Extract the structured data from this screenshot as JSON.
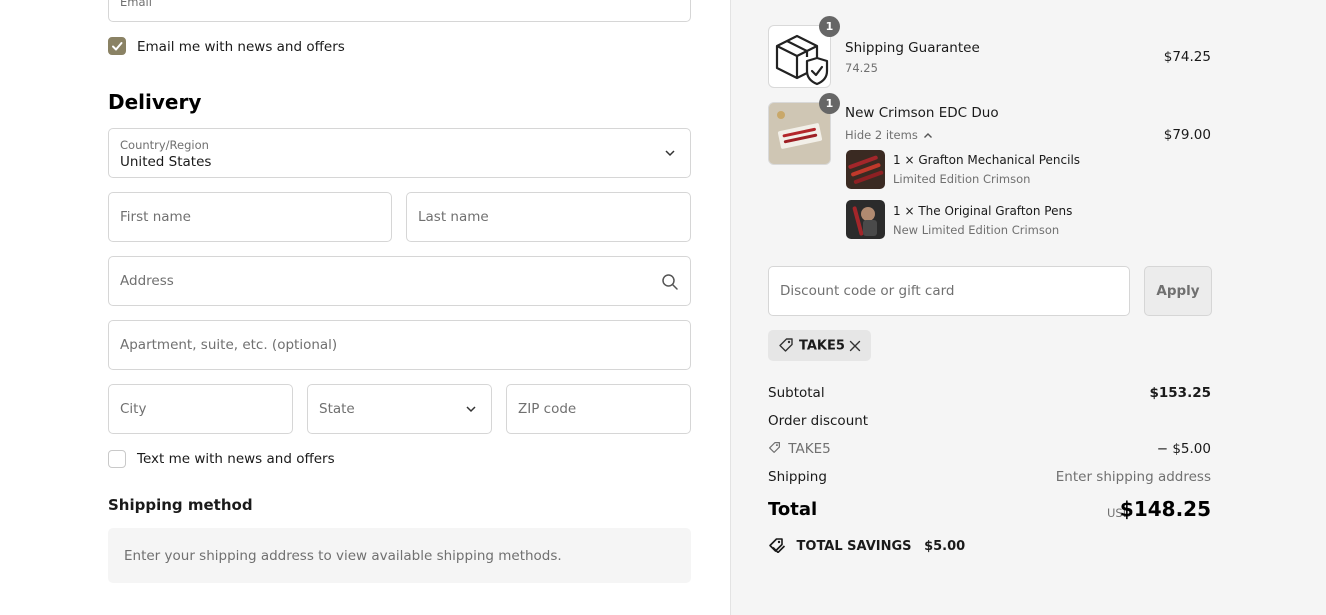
{
  "contact": {
    "email_placeholder": "Email",
    "news_checkbox_label": "Email me with news and offers",
    "news_checked": true
  },
  "delivery": {
    "heading": "Delivery",
    "country_label": "Country/Region",
    "country_value": "United States",
    "first_name_placeholder": "First name",
    "last_name_placeholder": "Last name",
    "address_placeholder": "Address",
    "apartment_placeholder": "Apartment, suite, etc. (optional)",
    "city_placeholder": "City",
    "state_placeholder": "State",
    "zip_placeholder": "ZIP code",
    "sms_checkbox_label": "Text me with news and offers",
    "sms_checked": false
  },
  "shipping_method": {
    "heading": "Shipping method",
    "message": "Enter your shipping address to view available shipping methods."
  },
  "order": {
    "items": [
      {
        "title": "Shipping Guarantee",
        "subtitle": "74.25",
        "price": "$74.25",
        "quantity": "1",
        "icon": "package-shield-icon"
      },
      {
        "title": "New Crimson EDC Duo",
        "toggle_label": "Hide 2 items",
        "price": "$79.00",
        "quantity": "1",
        "subitems": [
          {
            "title": "1 × Grafton Mechanical Pencils",
            "subtitle": "Limited Edition Crimson"
          },
          {
            "title": "1 × The Original Grafton Pens",
            "subtitle": "New Limited Edition Crimson"
          }
        ]
      }
    ],
    "discount_placeholder": "Discount code or gift card",
    "apply_label": "Apply",
    "applied_code": "TAKE5",
    "summary": {
      "subtotal_label": "Subtotal",
      "subtotal_value": "$153.25",
      "order_discount_label": "Order discount",
      "discount_code": "TAKE5",
      "discount_value": "− $5.00",
      "shipping_label": "Shipping",
      "shipping_value": "Enter shipping address",
      "total_label": "Total",
      "currency": "USD",
      "total_value": "$148.25",
      "savings_label": "TOTAL SAVINGS",
      "savings_value": "$5.00"
    }
  },
  "colors": {
    "checkbox_accent": "#8a8264",
    "summary_bg": "#f5f5f5",
    "border": "#d6d6d6"
  }
}
